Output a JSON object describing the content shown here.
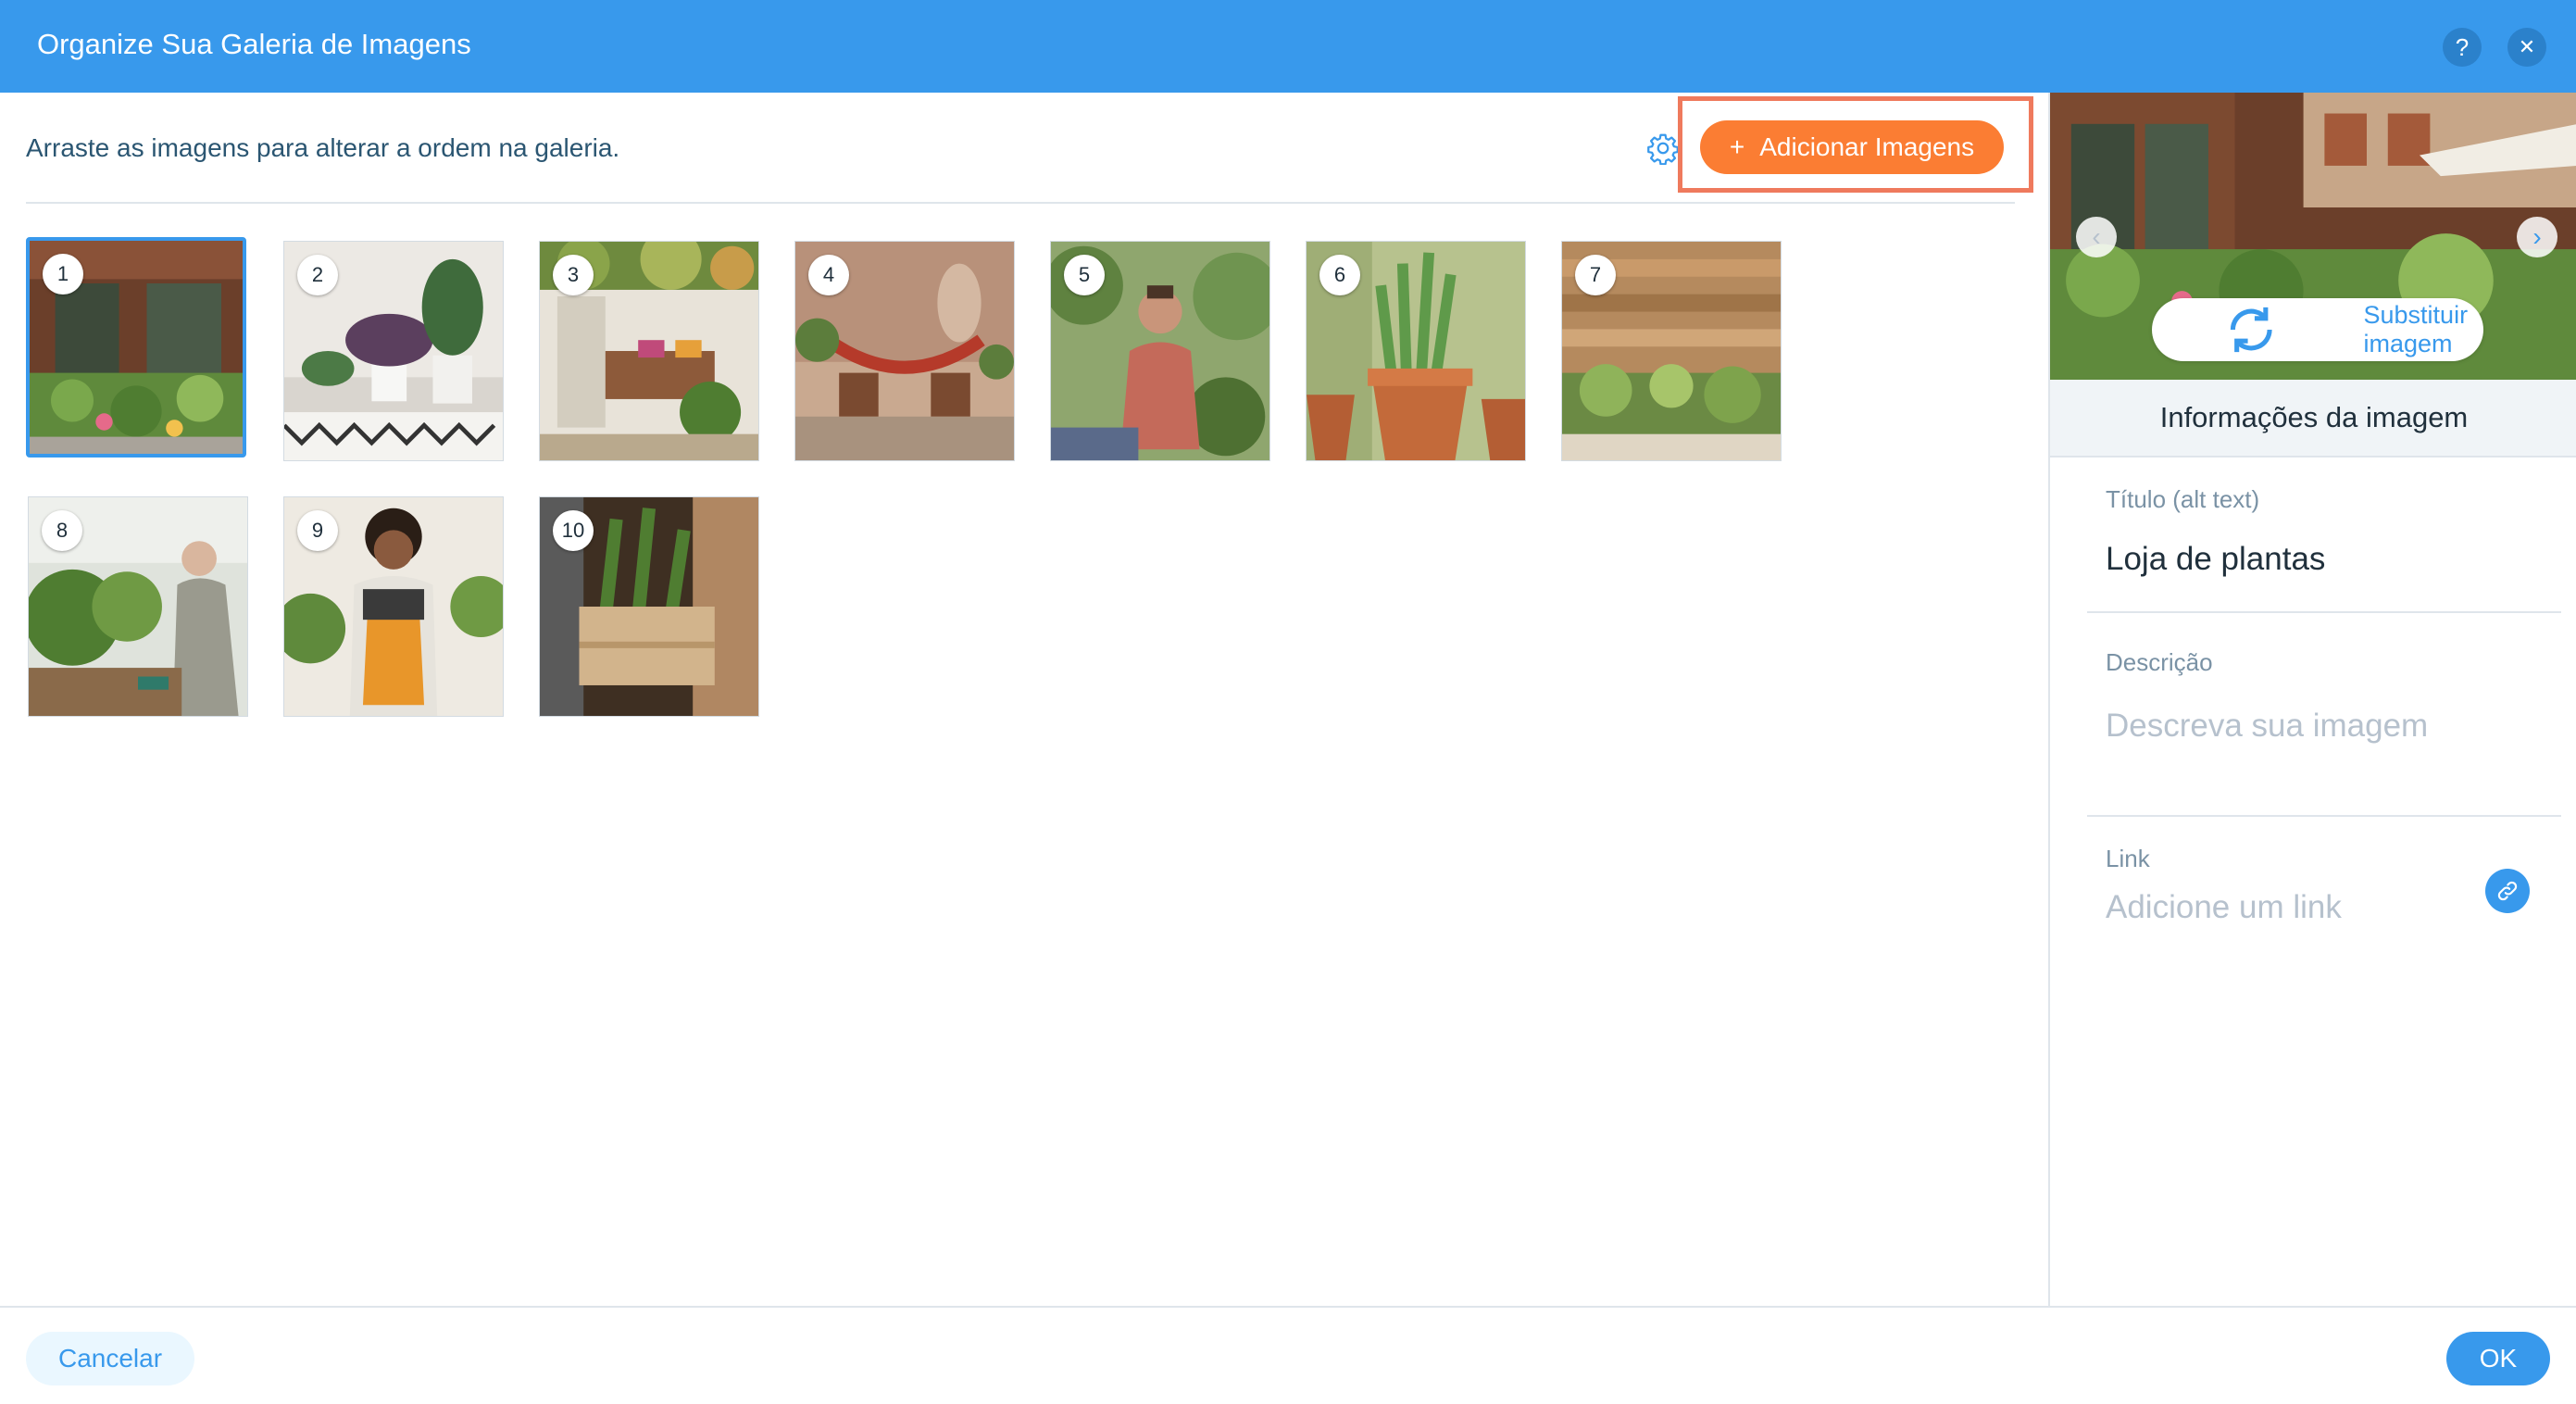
{
  "header": {
    "title": "Organize Sua Galeria de Imagens",
    "help_label": "?",
    "close_label": "✕"
  },
  "main": {
    "instruction": "Arraste as imagens para alterar a ordem na galeria.",
    "add_button_icon": "+",
    "add_button_label": "Adicionar Imagens",
    "selected_index": 1,
    "images": [
      {
        "number": "1"
      },
      {
        "number": "2"
      },
      {
        "number": "3"
      },
      {
        "number": "4"
      },
      {
        "number": "5"
      },
      {
        "number": "6"
      },
      {
        "number": "7"
      },
      {
        "number": "8"
      },
      {
        "number": "9"
      },
      {
        "number": "10"
      }
    ]
  },
  "sidebar": {
    "replace_label": "Substituir imagem",
    "info_title": "Informações da imagem",
    "title_label": "Título (alt text)",
    "title_value": "Loja de plantas",
    "description_label": "Descrição",
    "description_placeholder": "Descreva sua imagem",
    "link_label": "Link",
    "link_placeholder": "Adicione um link",
    "prev_arrow": "‹",
    "next_arrow": "›"
  },
  "footer": {
    "cancel_label": "Cancelar",
    "ok_label": "OK"
  },
  "colors": {
    "header": "#3899ec",
    "accent_orange": "#fb7d33",
    "highlight_box": "#ef7a5d",
    "primary_blue": "#3899ec"
  }
}
